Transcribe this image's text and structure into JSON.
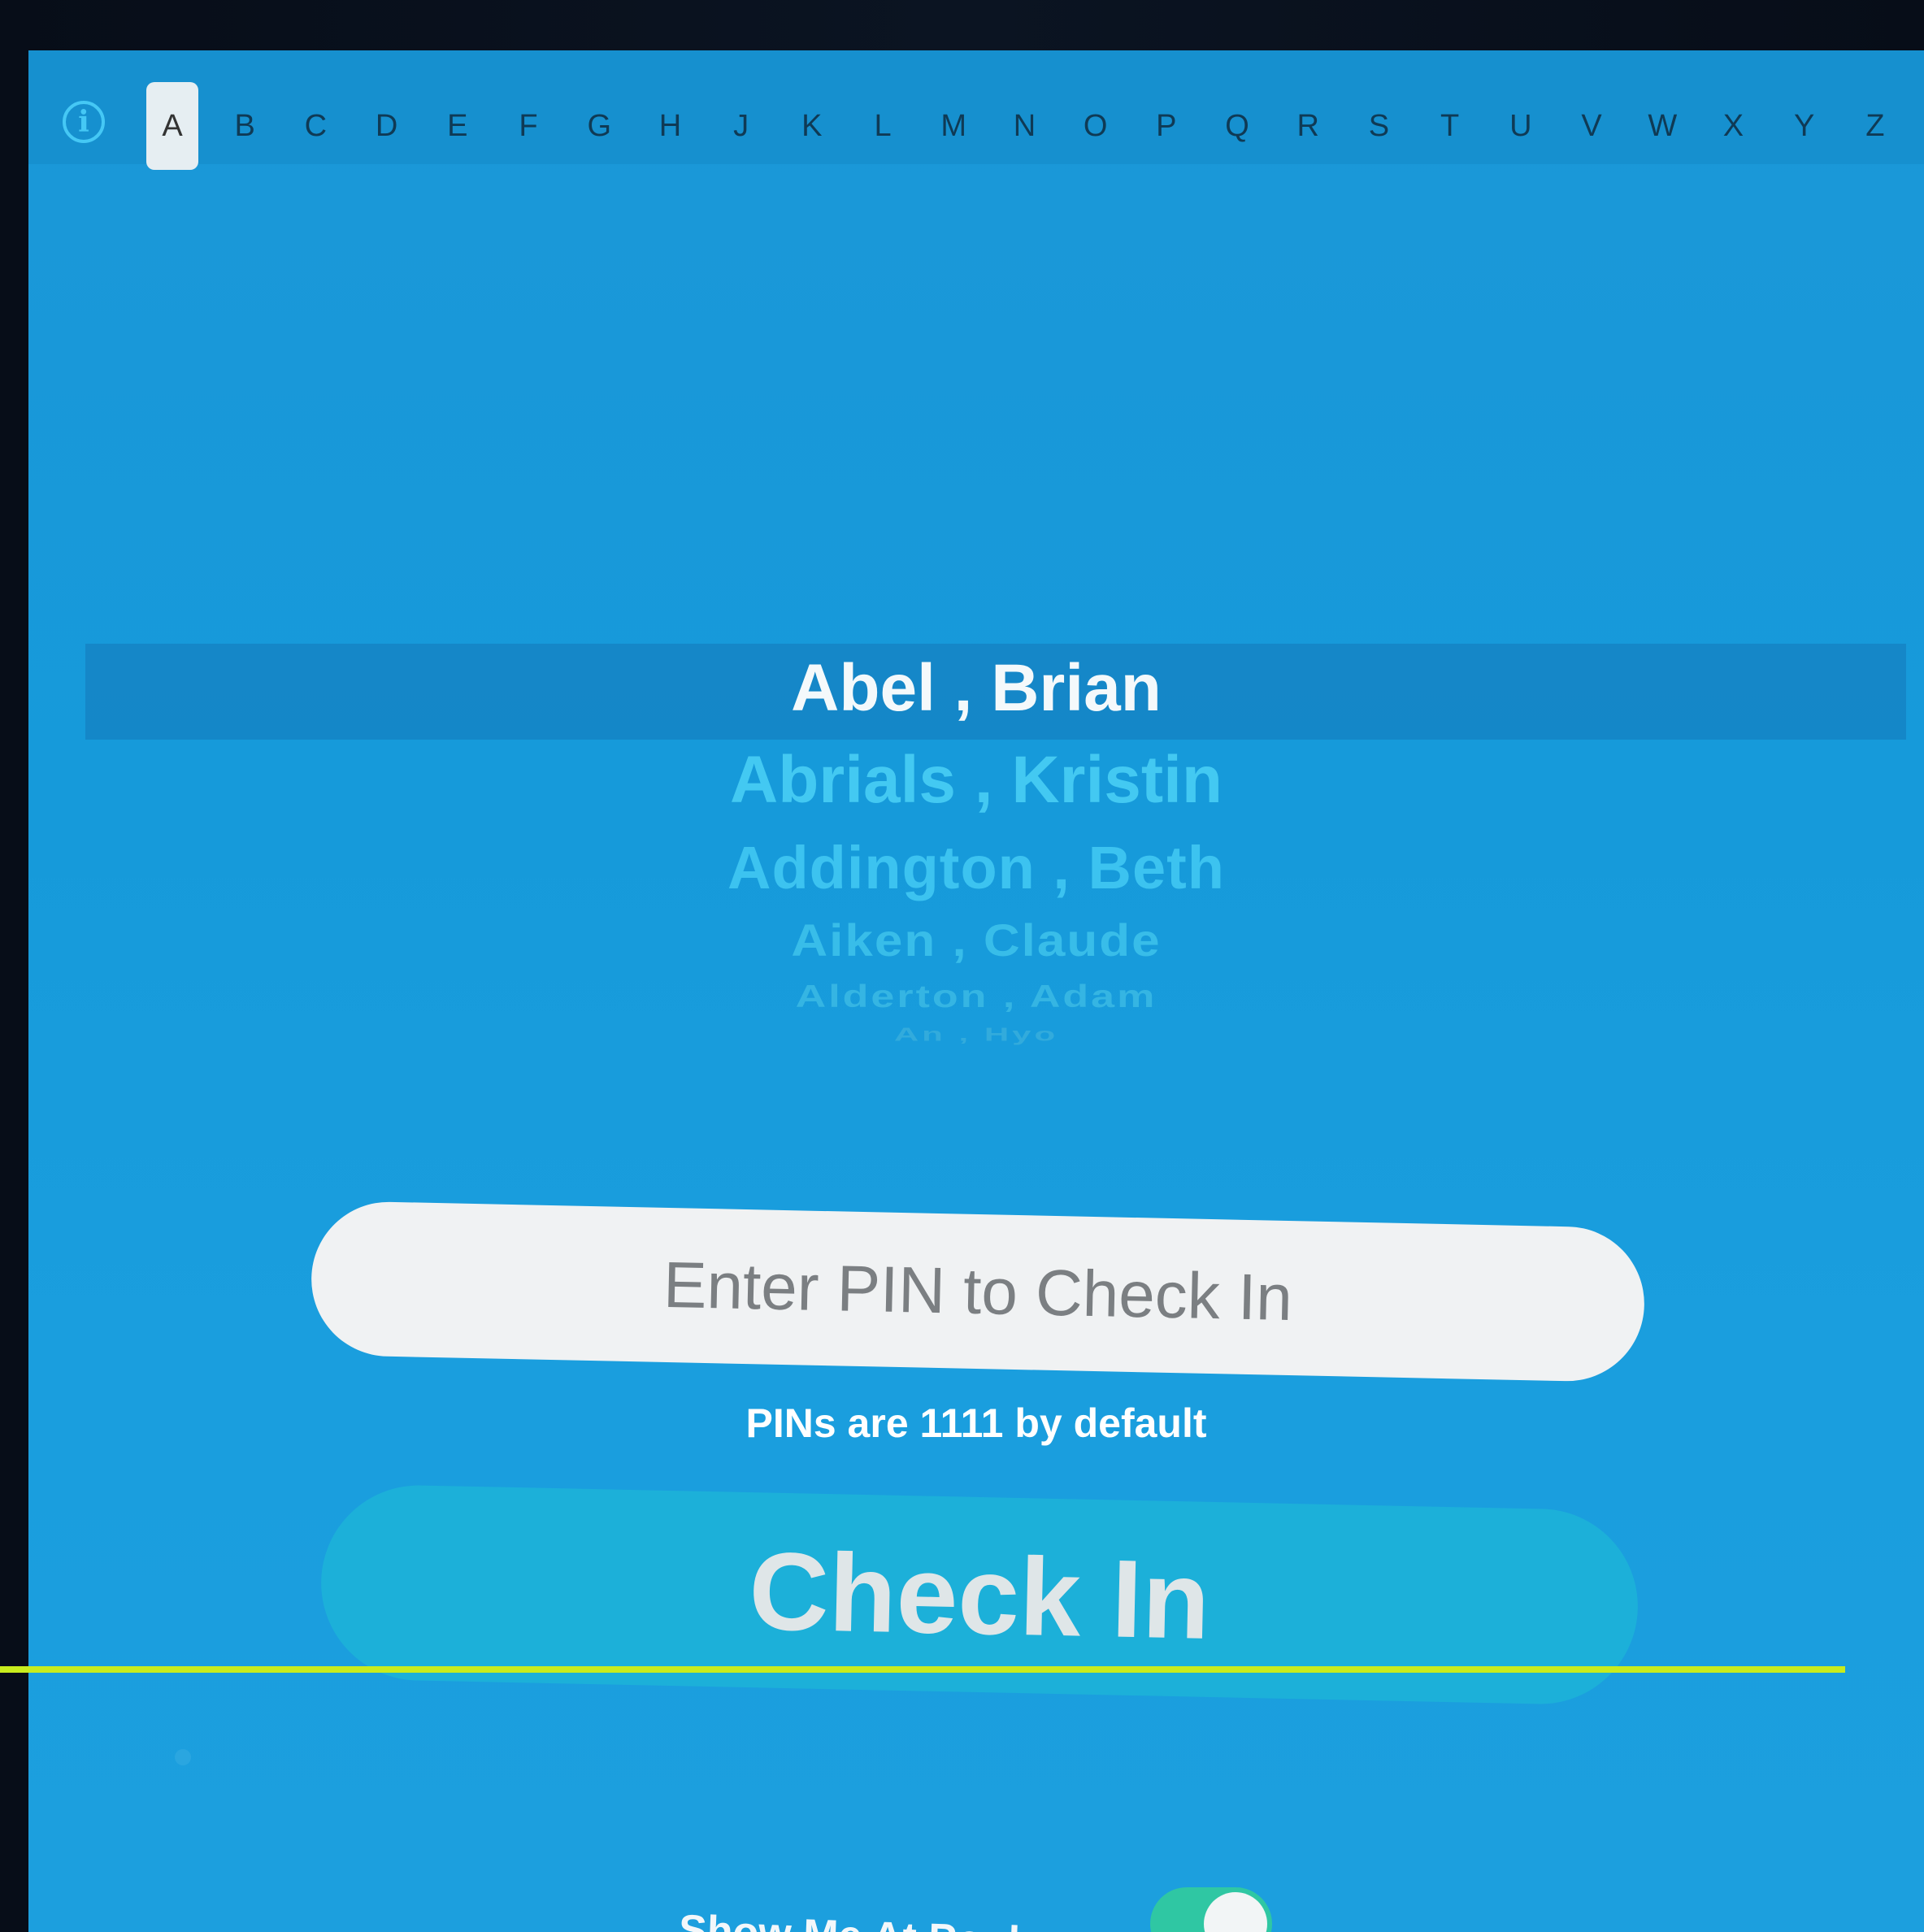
{
  "index_bar": {
    "info_icon": "info-circle-icon",
    "info_glyph": "i",
    "letters": [
      "A",
      "B",
      "C",
      "D",
      "E",
      "F",
      "G",
      "H",
      "J",
      "K",
      "L",
      "M",
      "N",
      "O",
      "P",
      "Q",
      "R",
      "S",
      "T",
      "U",
      "V",
      "W",
      "X",
      "Y",
      "Z"
    ],
    "selected": "A"
  },
  "picker": {
    "names": [
      "Abel , Brian",
      "Abrials , Kristin",
      "Addington , Beth",
      "Aiken , Claude",
      "Alderton , Adam",
      "An , Hyo"
    ]
  },
  "pin": {
    "placeholder": "Enter PIN to Check In",
    "value": "",
    "hint": "PINs are 1111 by default"
  },
  "checkin": {
    "label": "Check In"
  },
  "toggle": {
    "label": "Show Me At Pool",
    "on": true,
    "color": "#2fc7a3"
  },
  "colors": {
    "background": "#1a9ad9",
    "accent": "#43c9f2"
  }
}
